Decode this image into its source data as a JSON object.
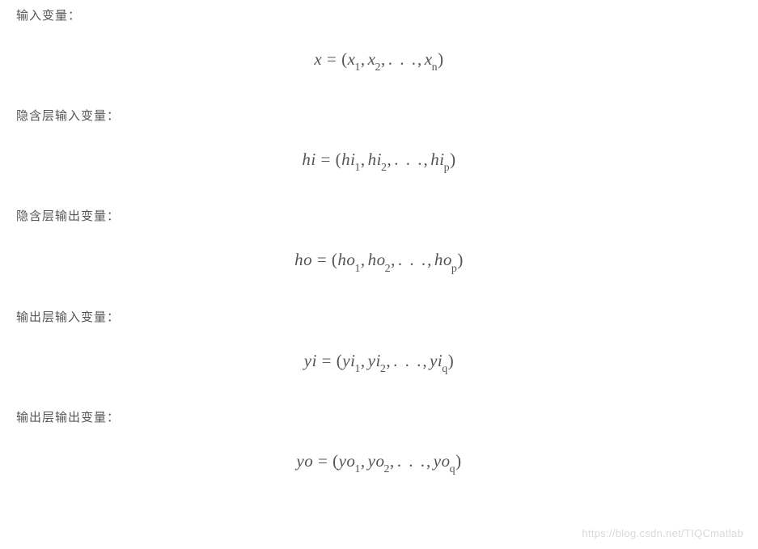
{
  "sections": [
    {
      "label": "输入变量：",
      "var": "x",
      "elem": "x",
      "idx": "n"
    },
    {
      "label": "隐含层输入变量：",
      "var": "hi",
      "elem": "hi",
      "idx": "p"
    },
    {
      "label": "隐含层输出变量：",
      "var": "ho",
      "elem": "ho",
      "idx": "p"
    },
    {
      "label": "输出层输入变量：",
      "var": "yi",
      "elem": "yi",
      "idx": "q"
    },
    {
      "label": "输出层输出变量：",
      "var": "yo",
      "elem": "yo",
      "idx": "q"
    }
  ],
  "punct": {
    "eq": " = ",
    "lparen": "(",
    "rparen": ")",
    "comma": ",",
    "dots": ". . ."
  },
  "subs": {
    "one": "1",
    "two": "2"
  },
  "watermark": "https://blog.csdn.net/TIQCmatlab"
}
